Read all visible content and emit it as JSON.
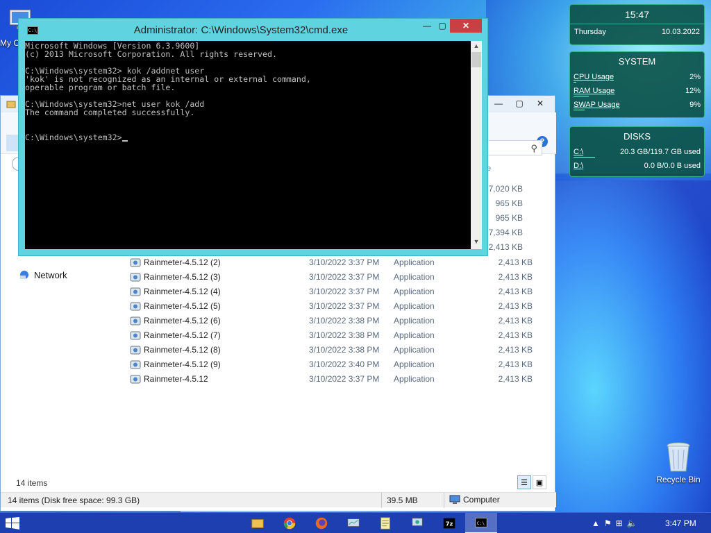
{
  "desktop": {
    "my_computer_label": "My C",
    "recycle_bin_label": "Recycle Bin"
  },
  "cmd": {
    "title": "Administrator: C:\\Windows\\System32\\cmd.exe",
    "lines": [
      "Microsoft Windows [Version 6.3.9600]",
      "(c) 2013 Microsoft Corporation. All rights reserved.",
      "",
      "C:\\Windows\\system32> kok /addnet user",
      "'kok' is not recognized as an internal or external command,",
      "operable program or batch file.",
      "",
      "C:\\Windows\\system32>net user kok /add",
      "The command completed successfully.",
      "",
      "",
      "C:\\Windows\\system32>"
    ]
  },
  "explorer": {
    "size_column_partial": "e",
    "network_label": "Network",
    "size_only_rows": [
      "7,020 KB",
      "965 KB",
      "965 KB",
      "7,394 KB",
      "2,413 KB"
    ],
    "files": [
      {
        "name": "Rainmeter-4.5.12 (2)",
        "date": "3/10/2022 3:37 PM",
        "type": "Application",
        "size": "2,413 KB"
      },
      {
        "name": "Rainmeter-4.5.12 (3)",
        "date": "3/10/2022 3:37 PM",
        "type": "Application",
        "size": "2,413 KB"
      },
      {
        "name": "Rainmeter-4.5.12 (4)",
        "date": "3/10/2022 3:37 PM",
        "type": "Application",
        "size": "2,413 KB"
      },
      {
        "name": "Rainmeter-4.5.12 (5)",
        "date": "3/10/2022 3:37 PM",
        "type": "Application",
        "size": "2,413 KB"
      },
      {
        "name": "Rainmeter-4.5.12 (6)",
        "date": "3/10/2022 3:38 PM",
        "type": "Application",
        "size": "2,413 KB"
      },
      {
        "name": "Rainmeter-4.5.12 (7)",
        "date": "3/10/2022 3:38 PM",
        "type": "Application",
        "size": "2,413 KB"
      },
      {
        "name": "Rainmeter-4.5.12 (8)",
        "date": "3/10/2022 3:38 PM",
        "type": "Application",
        "size": "2,413 KB"
      },
      {
        "name": "Rainmeter-4.5.12 (9)",
        "date": "3/10/2022 3:40 PM",
        "type": "Application",
        "size": "2,413 KB"
      },
      {
        "name": "Rainmeter-4.5.12",
        "date": "3/10/2022 3:37 PM",
        "type": "Application",
        "size": "2,413 KB"
      }
    ],
    "item_count": "14 items",
    "status_left": "14 items (Disk free space: 99.3 GB)",
    "status_size": "39.5 MB",
    "status_location": "Computer"
  },
  "rainmeter": {
    "time": "15:47",
    "day": "Thursday",
    "date": "10.03.2022",
    "system_title": "SYSTEM",
    "cpu_label": "CPU Usage",
    "cpu_value": "2%",
    "cpu_fraction": 0.02,
    "ram_label": "RAM Usage",
    "ram_value": "12%",
    "ram_fraction": 0.12,
    "swap_label": "SWAP Usage",
    "swap_value": "9%",
    "swap_fraction": 0.09,
    "disks_title": "DISKS",
    "c_label": "C:\\",
    "c_value": "20.3 GB/119.7 GB used",
    "c_fraction": 0.17,
    "d_label": "D:\\",
    "d_value": "0.0 B/0.0 B used",
    "d_fraction": 0.0
  },
  "taskbar": {
    "clock": "3:47 PM",
    "apps": [
      "file-explorer-icon",
      "chrome-icon",
      "firefox-icon",
      "monitor-icon",
      "notepad-icon",
      "network-icon",
      "7zip-icon",
      "cmd-icon"
    ],
    "active_app": "cmd-icon"
  }
}
